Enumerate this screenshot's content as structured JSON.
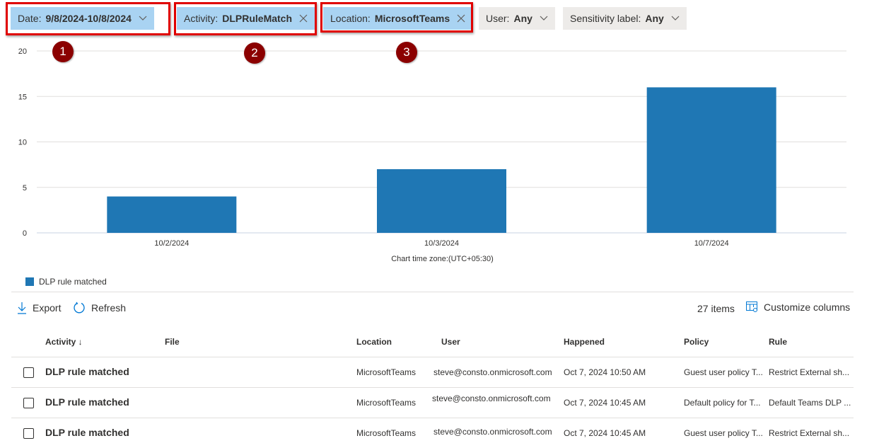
{
  "filters": [
    {
      "label": "Date:",
      "value": "9/8/2024-10/8/2024",
      "icon": "chevron-down-icon",
      "active": true
    },
    {
      "label": "Activity:",
      "value": "DLPRuleMatch",
      "icon": "close-icon",
      "active": true
    },
    {
      "label": "Location:",
      "value": "MicrosoftTeams",
      "icon": "close-icon",
      "active": true
    },
    {
      "label": "User:",
      "value": "Any",
      "icon": "chevron-down-icon",
      "active": false
    },
    {
      "label": "Sensitivity label:",
      "value": "Any",
      "icon": "chevron-down-icon",
      "active": false
    }
  ],
  "annotations": [
    "1",
    "2",
    "3"
  ],
  "chart_data": {
    "type": "bar",
    "categories": [
      "10/2/2024",
      "10/3/2024",
      "10/7/2024"
    ],
    "series": [
      {
        "name": "DLP rule matched",
        "values": [
          4,
          7,
          16
        ],
        "color": "#1f77b4"
      }
    ],
    "yticks": [
      0,
      5,
      10,
      15,
      20
    ],
    "ylim": [
      0,
      20
    ],
    "xlabel": "Chart time zone:(UTC+05:30)",
    "ylabel": "",
    "grid": true,
    "legend_position": "bottom-left"
  },
  "toolbar": {
    "export_label": "Export",
    "refresh_label": "Refresh",
    "items_count": "27 items",
    "customize_label": "Customize columns"
  },
  "table": {
    "columns": [
      "Activity ↓",
      "File",
      "Location",
      "User",
      "Happened",
      "Policy",
      "Rule"
    ],
    "rows": [
      {
        "activity": "DLP rule matched",
        "file": "",
        "location": "MicrosoftTeams",
        "user": "steve@consto.onmicrosoft.com",
        "happened": "Oct 7, 2024 10:50 AM",
        "policy": "Guest user policy T...",
        "rule": "Restrict External sh..."
      },
      {
        "activity": "DLP rule matched",
        "file": "",
        "location": "MicrosoftTeams",
        "user": "steve@consto.onmicrosoft.com",
        "happened": "Oct 7, 2024 10:45 AM",
        "policy": "Default policy for T...",
        "rule": "Default Teams DLP ..."
      },
      {
        "activity": "DLP rule matched",
        "file": "",
        "location": "MicrosoftTeams",
        "user": "steve@consto.onmicrosoft.com",
        "happened": "Oct 7, 2024 10:45 AM",
        "policy": "Guest user policy T...",
        "rule": "Restrict External sh..."
      }
    ]
  }
}
